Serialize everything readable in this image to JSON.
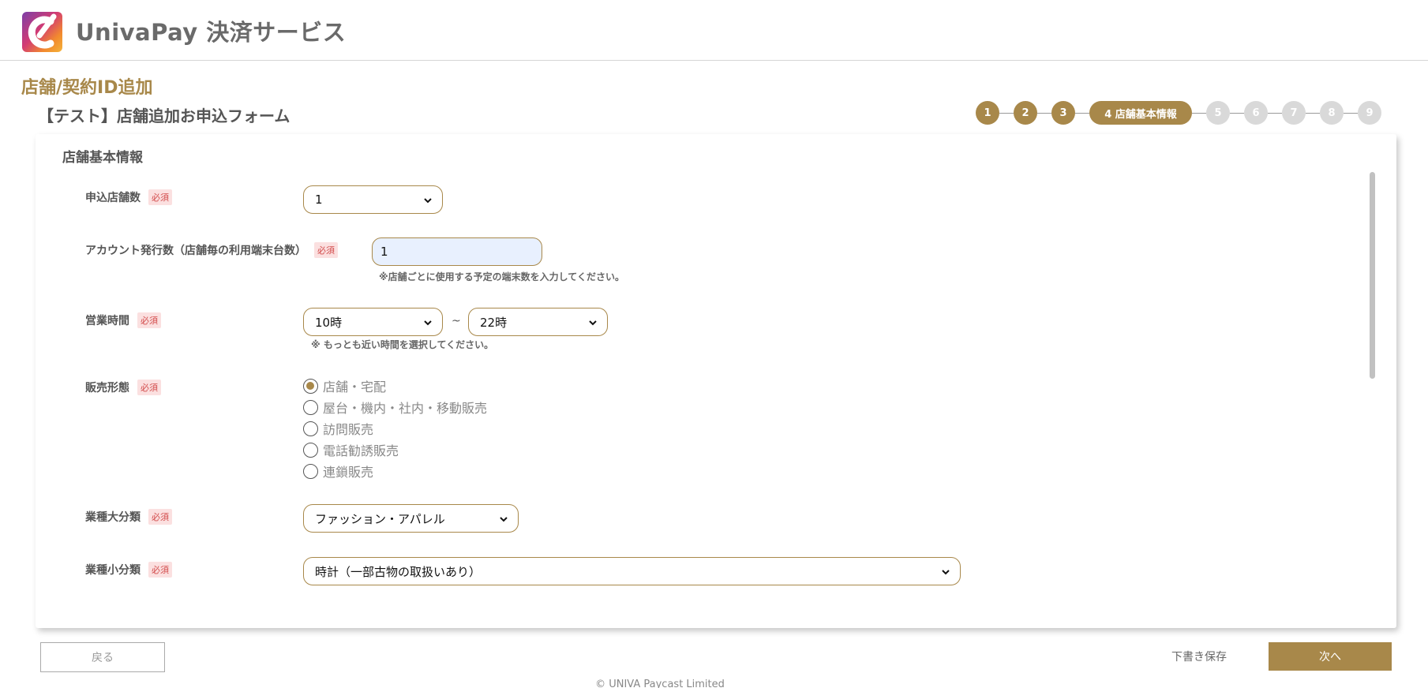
{
  "header": {
    "app_title": "UnivaPay 決済サービス",
    "logo_icon": "univapay-logo-icon"
  },
  "page": {
    "title": "店舗/契約ID追加",
    "form_title": "【テスト】店舗追加お申込フォーム"
  },
  "stepper": {
    "steps": [
      "1",
      "2",
      "3",
      "4 店舗基本情報",
      "5",
      "6",
      "7",
      "8",
      "9"
    ],
    "current": 4
  },
  "section": {
    "title": "店舗基本情報"
  },
  "required_badge": "必須",
  "fields": {
    "store_count": {
      "label": "申込店舗数",
      "value": "1"
    },
    "account_count": {
      "label": "アカウント発行数（店舗毎の利用端末台数）",
      "value": "1",
      "note": "※店舗ごとに使用する予定の端末数を入力してください。"
    },
    "business_hours": {
      "label": "営業時間",
      "from": "10時",
      "to": "22時",
      "separator": "~",
      "note": "※ もっとも近い時間を選択してください。"
    },
    "sales_type": {
      "label": "販売形態",
      "options": [
        "店舗・宅配",
        "屋台・機内・社内・移動販売",
        "訪問販売",
        "電話勧誘販売",
        "連鎖販売"
      ],
      "selected": "店舗・宅配"
    },
    "industry_major": {
      "label": "業種大分類",
      "value": "ファッション・アパレル"
    },
    "industry_minor": {
      "label": "業種小分類",
      "value": "時計（一部古物の取扱いあり）"
    }
  },
  "buttons": {
    "back": "戻る",
    "save_draft": "下書き保存",
    "next": "次へ"
  },
  "footer": {
    "copyright": "© UNIVA Paycast Limited"
  },
  "colors": {
    "accent": "#a8884a",
    "required": "#d24b4b",
    "inactive_step": "#d9d9d9"
  }
}
